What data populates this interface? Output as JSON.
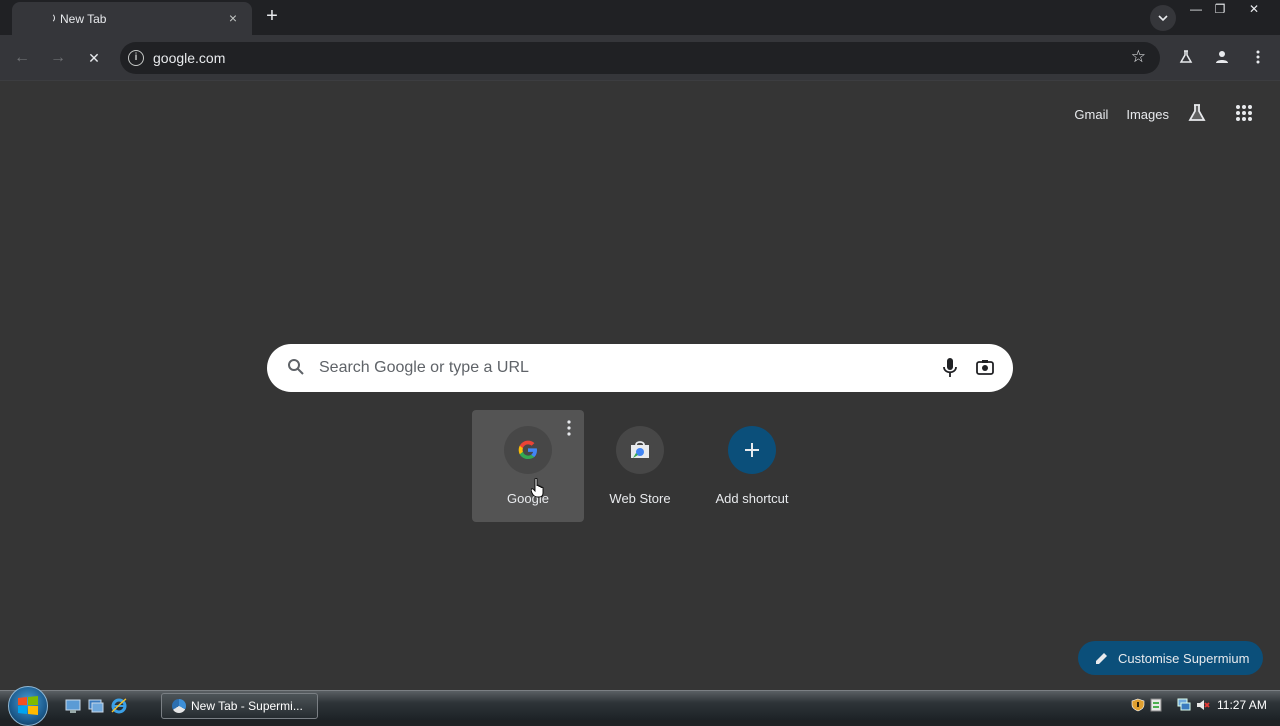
{
  "tab": {
    "title": "New Tab",
    "close": "×"
  },
  "newtab_label": "+",
  "window_controls": {
    "minimize": "—",
    "restore": "❐",
    "close": "✕"
  },
  "toolbar": {
    "url": "google.com",
    "back": "←",
    "forward": "→",
    "stop": "✕"
  },
  "top_links": {
    "gmail": "Gmail",
    "images": "Images"
  },
  "search": {
    "placeholder": "Search Google or type a URL"
  },
  "shortcuts": [
    {
      "label": "Google"
    },
    {
      "label": "Web Store"
    },
    {
      "label": "Add shortcut"
    }
  ],
  "customise": {
    "label": "Customise Supermium"
  },
  "taskbar": {
    "window_title": "New Tab - Supermi...",
    "clock": "11:27 AM"
  },
  "colors": {
    "accent": "#0b4f7a",
    "page_bg": "#353535",
    "chrome_bg": "#202124"
  }
}
